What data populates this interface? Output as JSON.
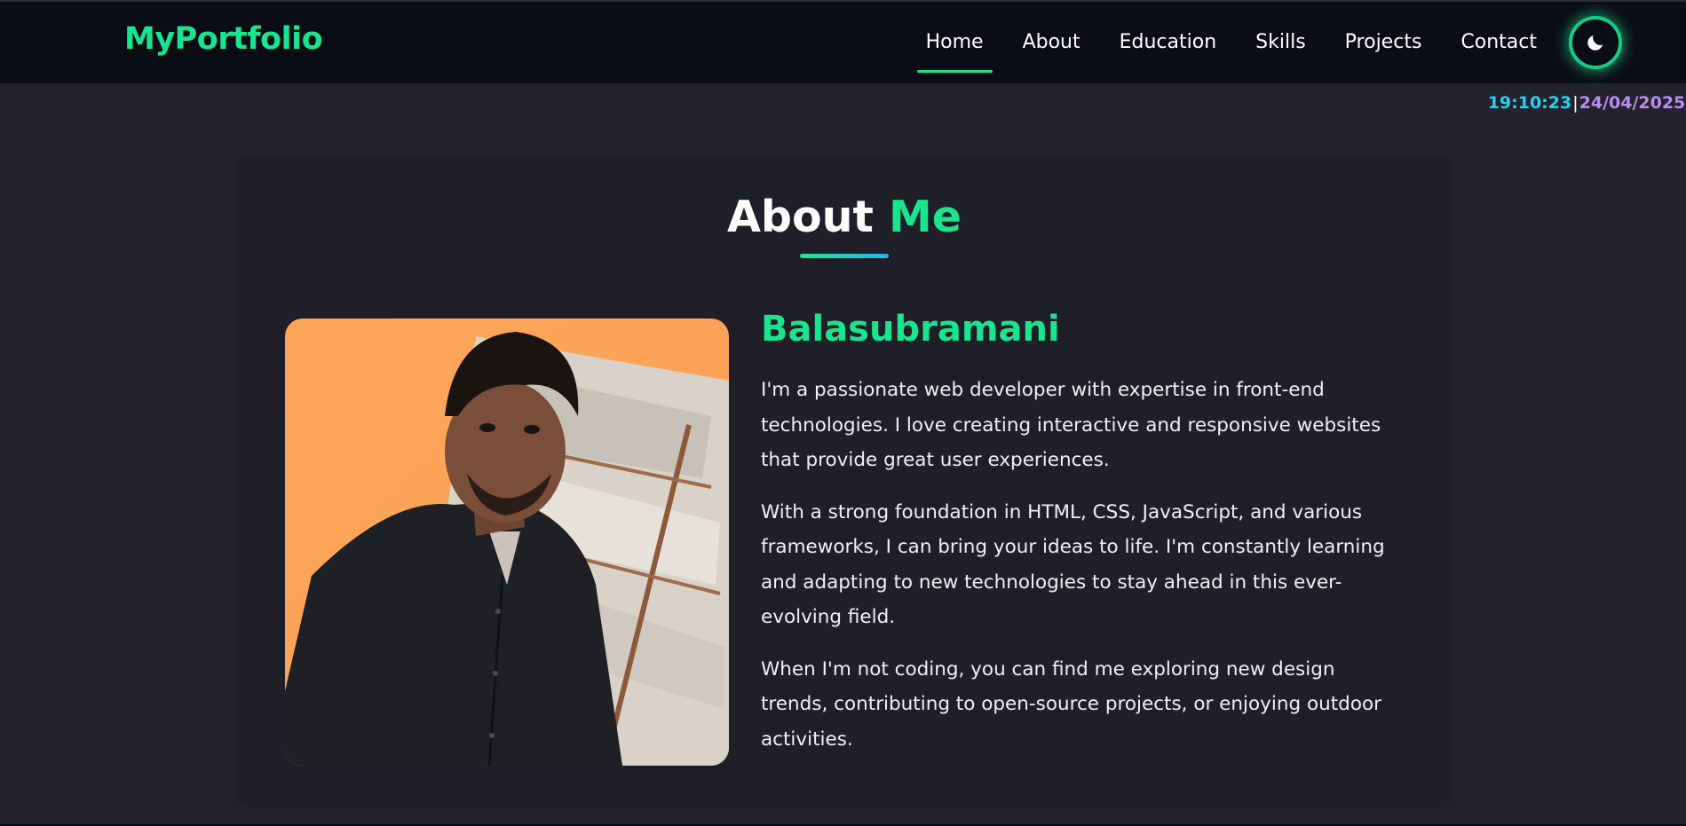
{
  "navbar": {
    "logo": "MyPortfolio",
    "links": [
      {
        "label": "Home",
        "active": true
      },
      {
        "label": "About",
        "active": false
      },
      {
        "label": "Education",
        "active": false
      },
      {
        "label": "Skills",
        "active": false
      },
      {
        "label": "Projects",
        "active": false
      },
      {
        "label": "Contact",
        "active": false
      }
    ],
    "theme_toggle_icon": "moon-icon"
  },
  "clock": {
    "time": "19:10:23",
    "separator": "|",
    "date": "24/04/2025"
  },
  "about": {
    "title_main": "About",
    "title_accent": "Me",
    "name": "Balasubramani",
    "paragraphs": [
      "I'm a passionate web developer with expertise in front-end technologies. I love creating interactive and responsive websites that provide great user experiences.",
      "With a strong foundation in HTML, CSS, JavaScript, and various frameworks, I can bring your ideas to life. I'm constantly learning and adapting to new technologies to stay ahead in this ever-evolving field.",
      "When I'm not coding, you can find me exploring new design trends, contributing to open-source projects, or enjoying outdoor activities."
    ]
  },
  "colors": {
    "accent": "#19e58e",
    "background": "#22222d",
    "navbar": "#0b0d16",
    "card": "#1e1f29",
    "clock_time": "#22d3ee",
    "clock_date": "#b98cf0"
  }
}
